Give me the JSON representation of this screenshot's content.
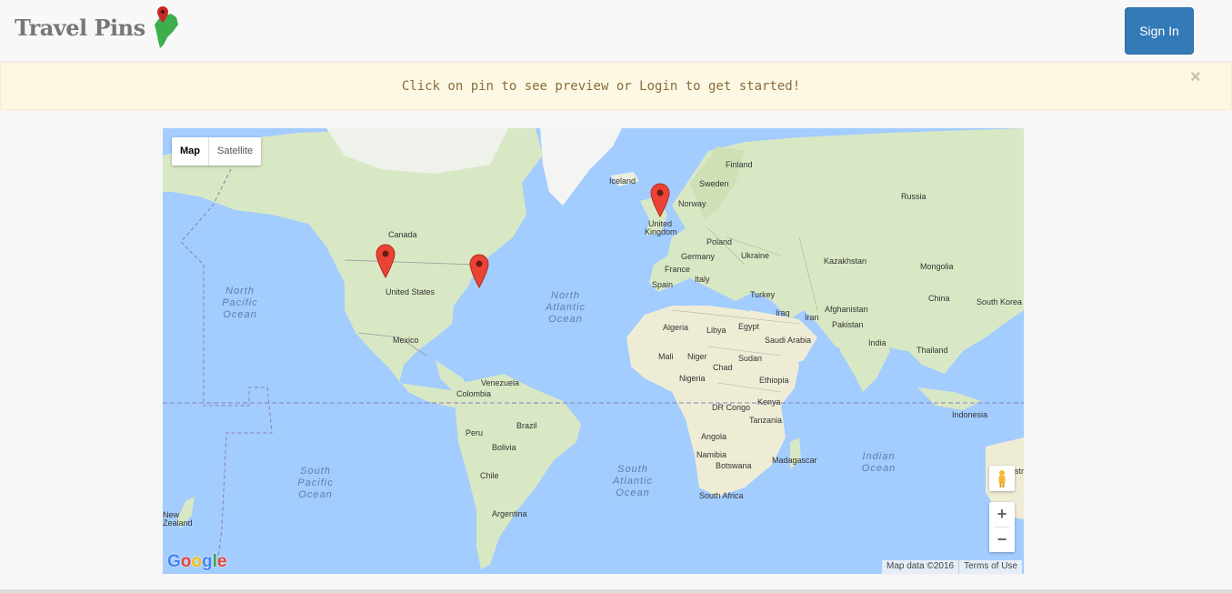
{
  "brand": {
    "title": "Travel Pins"
  },
  "nav": {
    "signin_label": "Sign In"
  },
  "alert": {
    "message": "Click on pin to see preview or Login to get started!",
    "close": "×"
  },
  "map": {
    "type_controls": {
      "map": "Map",
      "satellite": "Satellite"
    },
    "zoom": {
      "in": "+",
      "out": "−"
    },
    "attribution": {
      "data": "Map data ©2016",
      "terms": "Terms of Use"
    },
    "google": "Google",
    "countries": {
      "canada": "Canada",
      "united_states": "United States",
      "mexico": "Mexico",
      "venezuela": "Venezuela",
      "colombia": "Colombia",
      "peru": "Peru",
      "brazil": "Brazil",
      "bolivia": "Bolivia",
      "chile": "Chile",
      "argentina": "Argentina",
      "iceland": "Iceland",
      "finland": "Finland",
      "sweden": "Sweden",
      "norway": "Norway",
      "russia": "Russia",
      "uk_line1": "United",
      "uk_line2": "Kingdom",
      "poland": "Poland",
      "germany": "Germany",
      "ukraine": "Ukraine",
      "france": "France",
      "kazakhstan": "Kazakhstan",
      "mongolia": "Mongolia",
      "spain": "Spain",
      "italy": "Italy",
      "turkey": "Turkey",
      "china": "China",
      "south_korea": "South Korea",
      "iraq": "Iraq",
      "iran": "Iran",
      "afghanistan": "Afghanistan",
      "algeria": "Algeria",
      "libya": "Libya",
      "egypt": "Egypt",
      "pakistan": "Pakistan",
      "saudi_arabia": "Saudi Arabia",
      "india": "India",
      "thailand": "Thailand",
      "mali": "Mali",
      "niger": "Niger",
      "sudan": "Sudan",
      "chad": "Chad",
      "nigeria": "Nigeria",
      "ethiopia": "Ethiopia",
      "kenya": "Kenya",
      "dr_congo": "DR Congo",
      "tanzania": "Tanzania",
      "indonesia": "Indonesia",
      "angola": "Angola",
      "namibia": "Namibia",
      "botswana": "Botswana",
      "madagascar": "Madagascar",
      "south_africa": "South Africa",
      "new_zealand_1": "New",
      "new_zealand_2": "Zealand",
      "australia_partial": "stra"
    },
    "oceans": {
      "north_pacific": "North Pacific Ocean",
      "north_atlantic": "North Atlantic Ocean",
      "south_pacific": "South Pacific Ocean",
      "south_atlantic": "South Atlantic Ocean",
      "indian": "Indian Ocean"
    },
    "pins": [
      {
        "name": "pin-west-usa"
      },
      {
        "name": "pin-east-usa"
      },
      {
        "name": "pin-united-kingdom"
      }
    ]
  },
  "colors": {
    "primary": "#337ab7",
    "alert_bg": "#fcf8e3",
    "alert_text": "#8a6d3b",
    "pin": "#ea4335",
    "water": "#a3ccff",
    "land": "#d9e8c4"
  }
}
